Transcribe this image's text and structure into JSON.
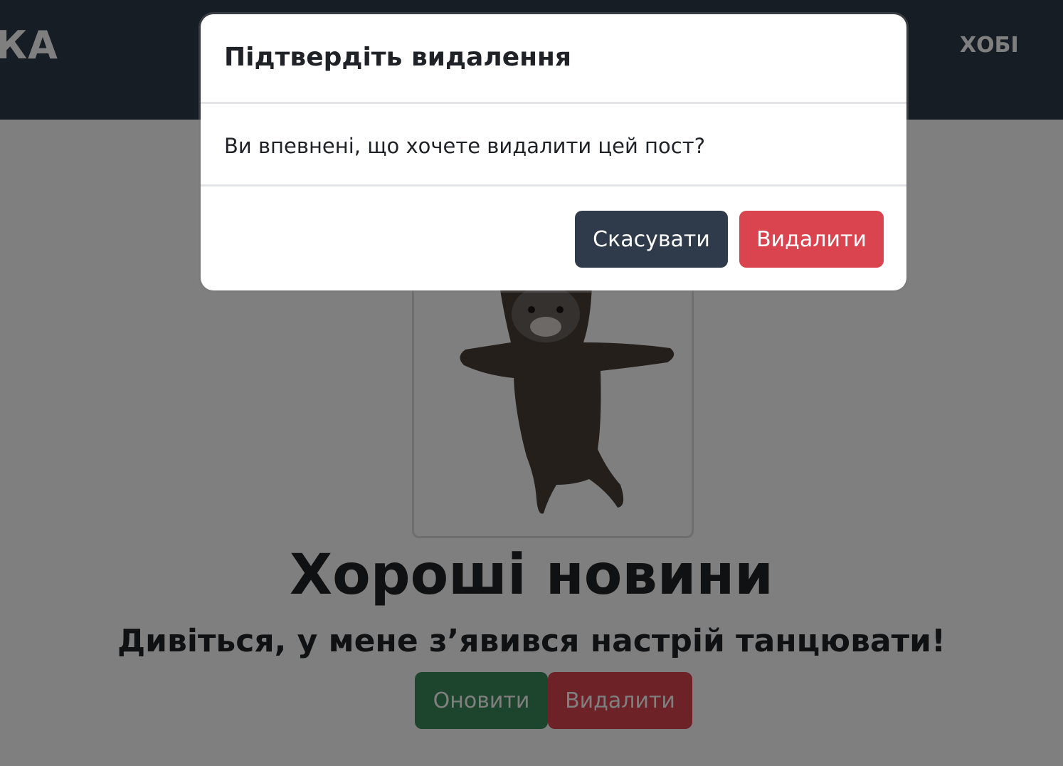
{
  "navbar": {
    "brand": "КА",
    "links": [
      "ХОБІ"
    ]
  },
  "post": {
    "image": "dancing-cat-image",
    "title": "Хороші новини",
    "subtitle": "Дивіться, у мене з’явився настрій танцювати!",
    "update_label": "Оновити",
    "delete_label": "Видалити"
  },
  "modal": {
    "title": "Підтвердіть видалення",
    "message": "Ви впевнені, що хочете видалити цей пост?",
    "cancel_label": "Скасувати",
    "confirm_label": "Видалити"
  },
  "colors": {
    "navbar": "#2f3b4b",
    "success": "#3a8a5a",
    "danger": "#d9444e",
    "backdrop": "rgba(0,0,0,0.5)"
  }
}
